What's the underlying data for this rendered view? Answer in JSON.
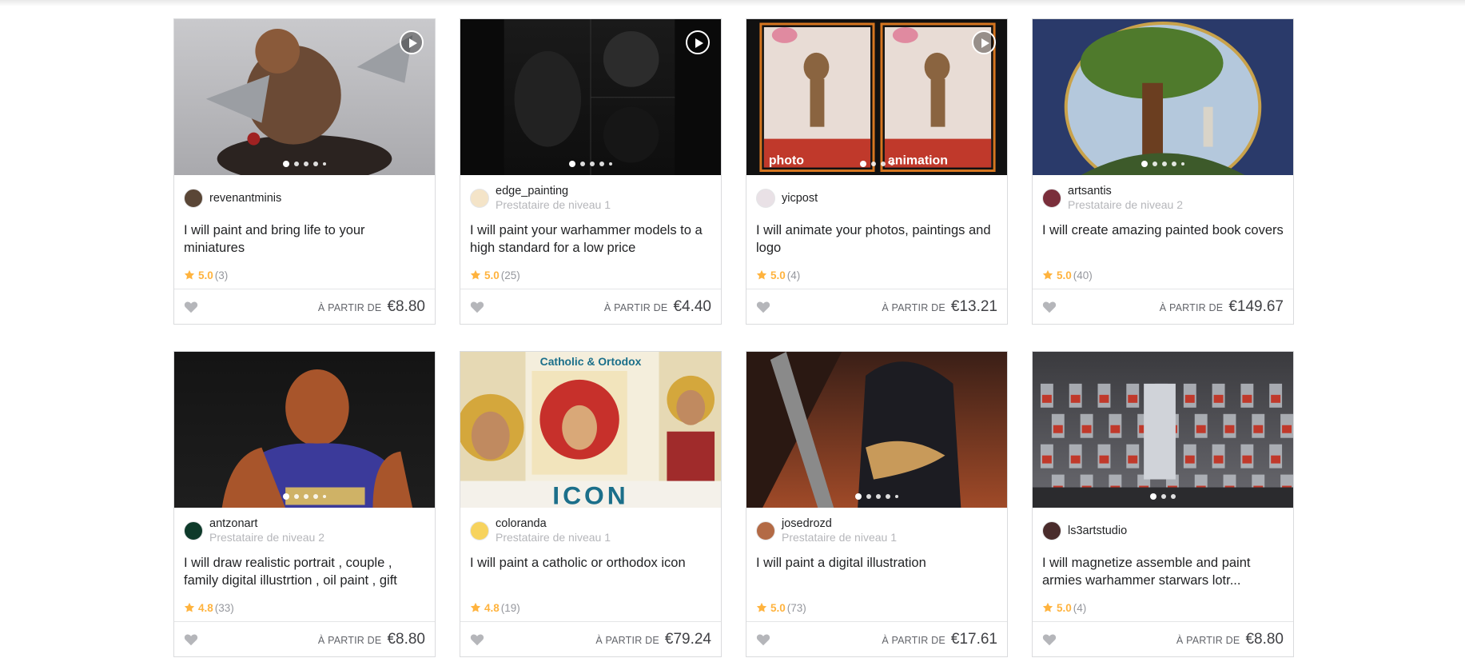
{
  "labels": {
    "from": "À PARTIR DE"
  },
  "gigs": [
    {
      "seller": "revenantminis",
      "level": "",
      "title": "I will paint and bring life to your miniatures",
      "score": "5.0",
      "count": "(3)",
      "price": "€8.80",
      "has_video": true,
      "dots": 5,
      "avatar_color": "#5a4636",
      "art": {
        "bg1": "#c9c9cc",
        "bg2": "#a9a9ad",
        "a": "#6b4a35",
        "b": "#9b9ea3",
        "c": "#2b2320"
      }
    },
    {
      "seller": "edge_painting",
      "level": "Prestataire de niveau 1",
      "title": "I will paint your warhammer models to a high standard for a low price",
      "score": "5.0",
      "count": "(25)",
      "price": "€4.40",
      "has_video": true,
      "dots": 5,
      "avatar_color": "#f4e4c8",
      "art": {
        "bg1": "#1a1a1a",
        "bg2": "#0e0e0e",
        "a": "#222222",
        "b": "#2c2c2c",
        "c": "#161616"
      }
    },
    {
      "seller": "yicpost",
      "level": "",
      "title": "I will animate your photos, paintings and logo",
      "score": "5.0",
      "count": "(4)",
      "price": "€13.21",
      "has_video": true,
      "dots": 4,
      "avatar_color": "#e9e1e6",
      "photo_label": "photo",
      "anim_label": "animation",
      "art": {
        "bg1": "#c0392b",
        "bg2": "#e8dcd5",
        "a": "#8a6440",
        "b": "#d67620",
        "c": "#111111"
      }
    },
    {
      "seller": "artsantis",
      "level": "Prestataire de niveau 2",
      "title": "I will create amazing painted book covers",
      "score": "5.0",
      "count": "(40)",
      "price": "€149.67",
      "has_video": false,
      "dots": 5,
      "avatar_color": "#7a2e3b",
      "art": {
        "bg1": "#2a3a6a",
        "bg2": "#8fa7c4",
        "a": "#4f7a2c",
        "b": "#c9b070",
        "c": "#6b3e20"
      }
    },
    {
      "seller": "antzonart",
      "level": "Prestataire de niveau 2",
      "title": "I will draw realistic portrait , couple , family digital illustrtion , oil paint , gift",
      "score": "4.8",
      "count": "(33)",
      "price": "€8.80",
      "has_video": false,
      "dots": 5,
      "avatar_color": "#0e3a2a",
      "art": {
        "bg1": "#141414",
        "bg2": "#1e1e1e",
        "a": "#a8552b",
        "b": "#3b3a9a",
        "c": "#e0c060"
      }
    },
    {
      "seller": "coloranda",
      "level": "Prestataire de niveau 1",
      "title": "I will paint a catholic or orthodox icon",
      "score": "4.8",
      "count": "(19)",
      "price": "€79.24",
      "has_video": false,
      "dots": 0,
      "avatar_color": "#f7d35e",
      "banner": "Catholic & Ortodox",
      "icon_word": "ICON",
      "art": {
        "bg1": "#f4eedc",
        "bg2": "#e8d9b0",
        "a": "#c7302b",
        "b": "#d4a73c",
        "c": "#1b6f8a"
      }
    },
    {
      "seller": "josedrozd",
      "level": "Prestataire de niveau 1",
      "title": "I will paint a digital illustration",
      "score": "5.0",
      "count": "(73)",
      "price": "€17.61",
      "has_video": false,
      "dots": 5,
      "avatar_color": "#b36a45",
      "art": {
        "bg1": "#3a1f17",
        "bg2": "#a04a28",
        "a": "#1c1c22",
        "b": "#c89a5a",
        "c": "#e8b9a0"
      }
    },
    {
      "seller": "ls3artstudio",
      "level": "",
      "title": "I will magnetize assemble and paint armies warhammer starwars lotr...",
      "score": "5.0",
      "count": "(4)",
      "price": "€8.80",
      "has_video": false,
      "dots": 3,
      "avatar_color": "#4a2c2c",
      "art": {
        "bg1": "#3a3a3e",
        "bg2": "#6a6a70",
        "a": "#b9bcc2",
        "b": "#c0392b",
        "c": "#2b2b2e"
      }
    }
  ]
}
